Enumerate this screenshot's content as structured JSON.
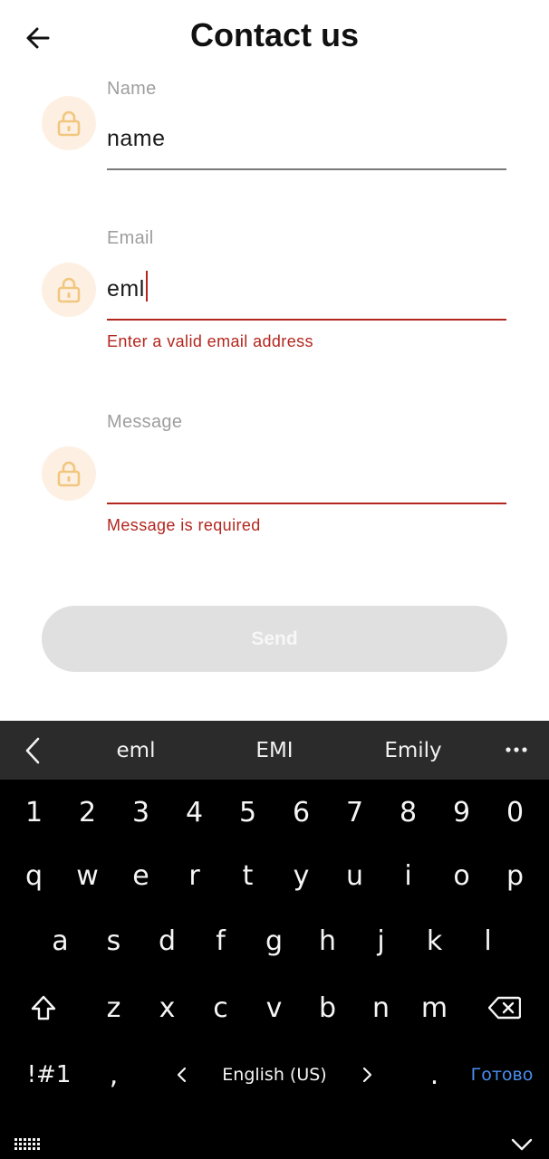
{
  "header": {
    "title": "Contact us"
  },
  "form": {
    "name": {
      "label": "Name",
      "value": "name"
    },
    "email": {
      "label": "Email",
      "value": "eml",
      "error": "Enter a valid email address"
    },
    "message": {
      "label": "Message",
      "value": "",
      "error": "Message is required"
    },
    "send_label": "Send"
  },
  "colors": {
    "accent_error": "#b3261e",
    "icon_bg": "#fdf0e2",
    "icon_fg": "#f1c67e",
    "button_disabled": "#e0e0e0"
  },
  "keyboard": {
    "suggestions": [
      "eml",
      "EMI",
      "Emily"
    ],
    "row_numbers": [
      "1",
      "2",
      "3",
      "4",
      "5",
      "6",
      "7",
      "8",
      "9",
      "0"
    ],
    "row1": [
      "q",
      "w",
      "e",
      "r",
      "t",
      "y",
      "u",
      "i",
      "o",
      "p"
    ],
    "row2": [
      "a",
      "s",
      "d",
      "f",
      "g",
      "h",
      "j",
      "k",
      "l"
    ],
    "row3": [
      "z",
      "x",
      "c",
      "v",
      "b",
      "n",
      "m"
    ],
    "symbols_label": "!#1",
    "comma": ",",
    "language": "English (US)",
    "period": ".",
    "done_label": "Готово"
  }
}
